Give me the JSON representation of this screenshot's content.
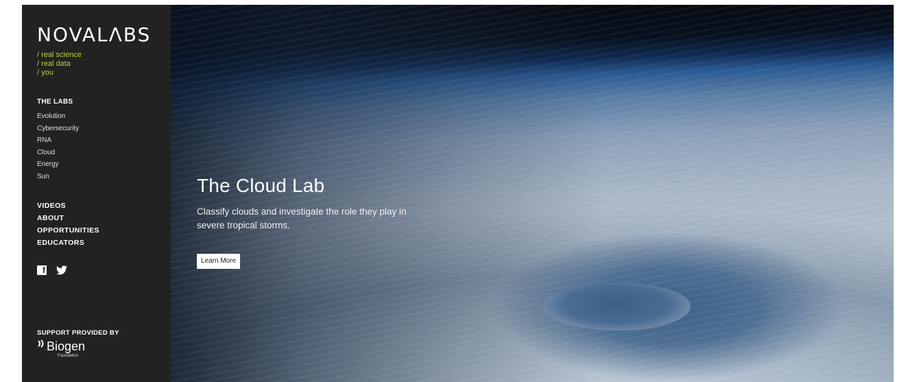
{
  "brand": {
    "logo": "NOVALΛBS",
    "tagline": [
      "/ real science",
      "/ real data",
      "/ you"
    ]
  },
  "sidebar": {
    "labs_heading": "THE LABS",
    "labs": [
      "Evolution",
      "Cybersecurity",
      "RNA",
      "Cloud",
      "Energy",
      "Sun"
    ],
    "nav": [
      "VIDEOS",
      "ABOUT",
      "OPPORTUNITIES",
      "EDUCATORS"
    ],
    "social_icons": [
      "facebook-icon",
      "twitter-icon"
    ],
    "support_heading": "SUPPORT PROVIDED BY",
    "sponsor_name": "Biogen",
    "sponsor_sub": "Foundation"
  },
  "hero": {
    "title": "The Cloud Lab",
    "description": "Classify clouds and investigate the role they play in severe tropical storms.",
    "button_label": "Learn More"
  },
  "colors": {
    "sidebar_bg": "#222222",
    "tagline": "#b4d43a"
  }
}
